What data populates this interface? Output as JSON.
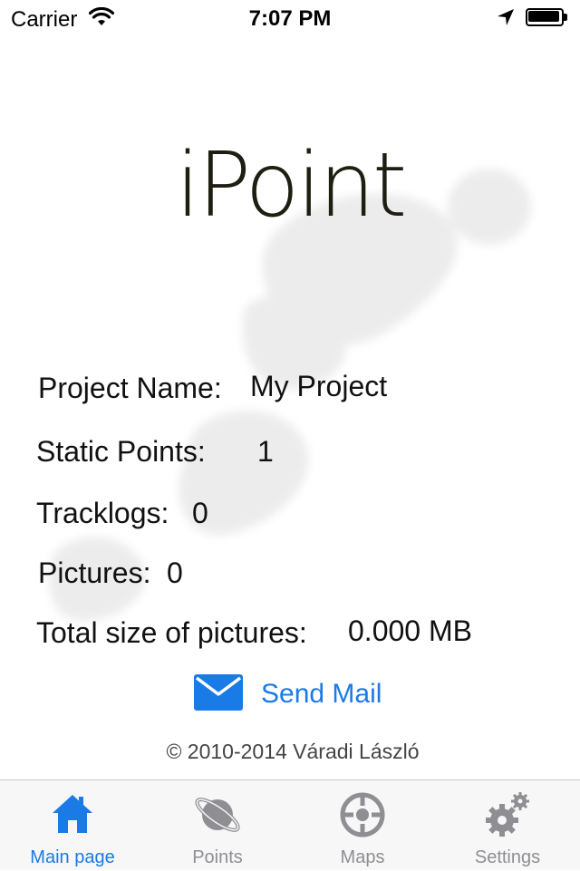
{
  "status_bar": {
    "carrier": "Carrier",
    "time": "7:07 PM",
    "icons": [
      "wifi-icon",
      "location-arrow-icon",
      "battery-icon"
    ]
  },
  "app": {
    "logo_text": "iPoint"
  },
  "project": {
    "name_label": "Project Name:",
    "name_value": "My Project",
    "static_points_label": "Static Points:",
    "static_points_value": "1",
    "tracklogs_label": "Tracklogs:",
    "tracklogs_value": "0",
    "pictures_label": "Pictures:",
    "pictures_value": "0",
    "total_size_label": "Total size of pictures:",
    "total_size_value": "0.000 MB"
  },
  "actions": {
    "send_mail_label": "Send Mail",
    "send_mail_icon": "envelope-icon"
  },
  "footer": {
    "copyright": "© 2010-2014 Váradi László"
  },
  "tab_bar": {
    "active_color": "#1a7ae6",
    "inactive_color": "#8e8e93",
    "tabs": [
      {
        "label": "Main page",
        "icon": "home-icon",
        "active": true
      },
      {
        "label": "Points",
        "icon": "planet-icon",
        "active": false
      },
      {
        "label": "Maps",
        "icon": "crosshair-icon",
        "active": false
      },
      {
        "label": "Settings",
        "icon": "gears-icon",
        "active": false
      }
    ]
  }
}
